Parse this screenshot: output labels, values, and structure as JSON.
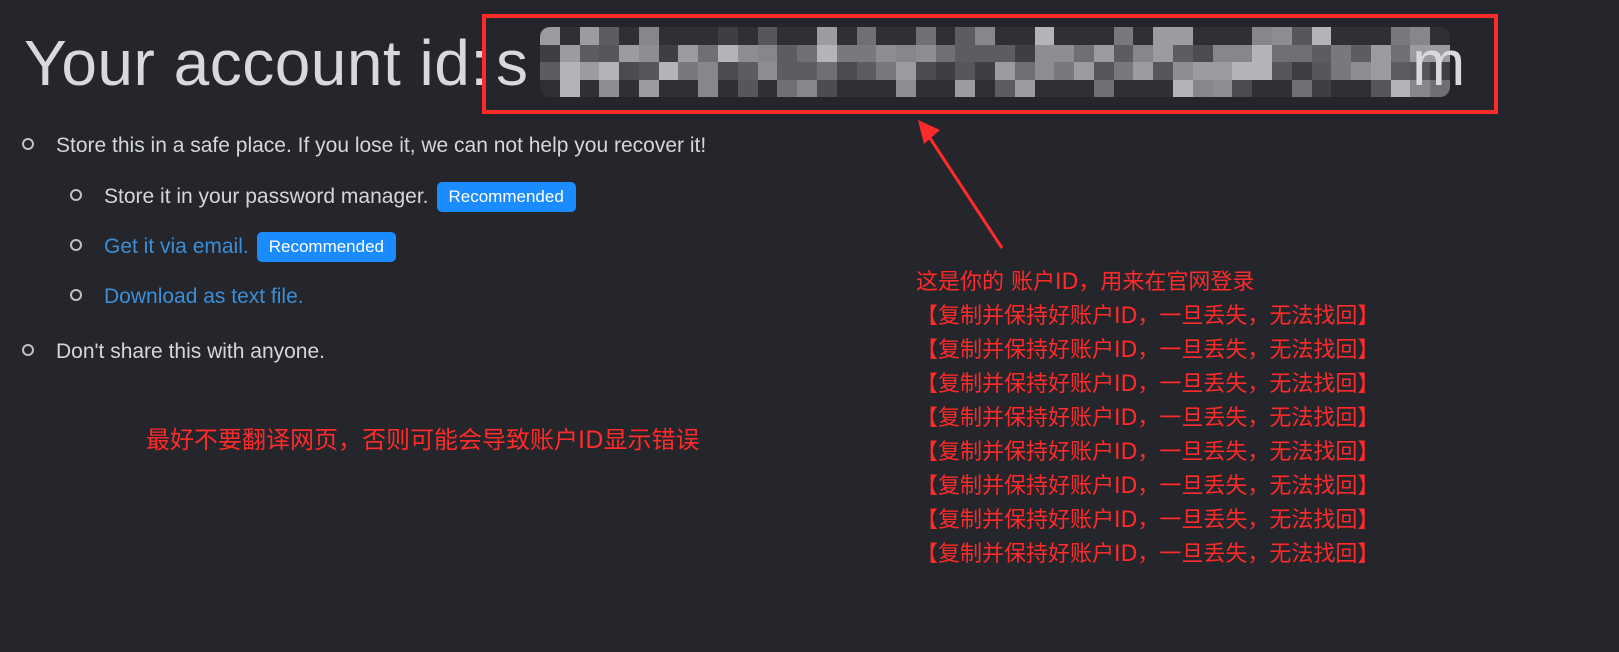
{
  "header": {
    "title": "Your account id:",
    "account_id_prefix": "s",
    "account_id_suffix": "m"
  },
  "colors": {
    "background": "#24262b",
    "text": "#d8d9db",
    "link": "#3b8ed8",
    "badge": "#1a8cff",
    "annotation": "#ff2a2a"
  },
  "list": {
    "store_safe": "Store this in a safe place. If you lose it, we can not help you recover it!",
    "password_manager": "Store it in your password manager.",
    "email_link": "Get it via email.",
    "download_link": "Download as text file.",
    "recommended_badge": "Recommended",
    "dont_share": "Don't share this with anyone."
  },
  "annotations": {
    "translate_warning": "最好不要翻译网页，否则可能会导致账户ID显示错误",
    "account_id_note": "这是你的 账户ID，用来在官网登录",
    "repeat_warning": [
      "【复制并保持好账户ID，一旦丢失，无法找回】",
      "【复制并保持好账户ID，一旦丢失，无法找回】",
      "【复制并保持好账户ID，一旦丢失，无法找回】",
      "【复制并保持好账户ID，一旦丢失，无法找回】",
      "【复制并保持好账户ID，一旦丢失，无法找回】",
      "【复制并保持好账户ID，一旦丢失，无法找回】",
      "【复制并保持好账户ID，一旦丢失，无法找回】",
      "【复制并保持好账户ID，一旦丢失，无法找回】"
    ]
  }
}
